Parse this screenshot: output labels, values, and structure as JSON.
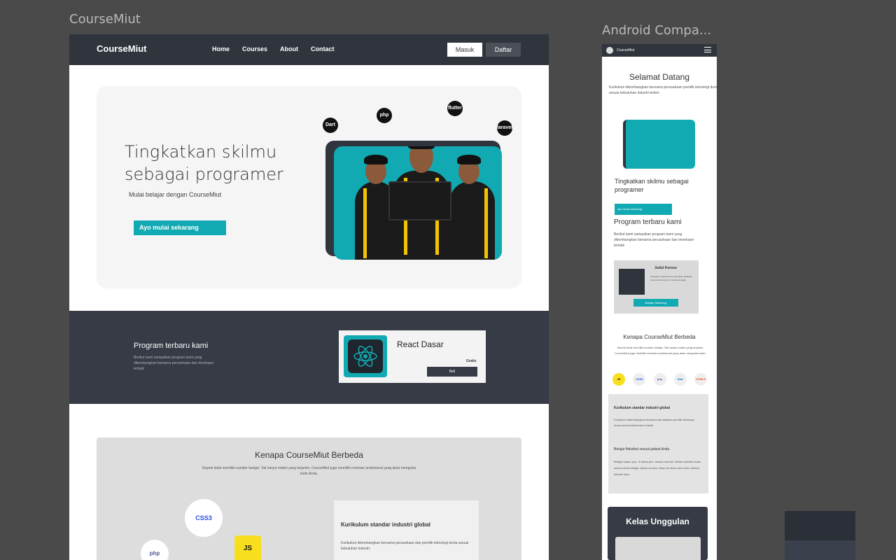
{
  "canvas": {
    "desktop_frame_label": "CourseMiut",
    "mobile_frame_label": "Android Compa..."
  },
  "desktop": {
    "nav": {
      "brand": "CourseMiut",
      "links": [
        "Home",
        "Courses",
        "About",
        "Contact"
      ],
      "login": "Masuk",
      "register": "Daftar"
    },
    "hero": {
      "title": "Tingkatkan skilmu sebagai programer",
      "subtitle": "Mulai belajar dengan CourseMiut",
      "cta": "Ayo mulai sekarang",
      "tech_badges": [
        "Dart",
        "php",
        "flutter",
        "laravel"
      ]
    },
    "program": {
      "title": "Program terbaru kami",
      "description": "Berikut kami sampaikan program kami yang dikembangkan bersama perusahaan dan developer terbaik",
      "card": {
        "title": "React Dasar",
        "price": "Gratis",
        "button": "Beli"
      }
    },
    "why": {
      "title": "Kenapa CourseMiut Berbeda",
      "description": "Seperti tidak memiliki sumber belajar. Tak hanya materi yang terjamin, CourseMiut juga memiliki reviewer profesional yang akan mengulas kode Anda.",
      "card_title": "Kurikulum standar industri global",
      "card_desc": "Kurikulum dikembangkan bersama perusahaan dan pemilik teknologi dunia sesuai kebutuhan industri.",
      "icons": [
        "CSS3",
        "JS",
        "php"
      ]
    }
  },
  "mobile": {
    "brand": "CourseMiut",
    "welcome": "Selamat Datang",
    "welcome_desc": "Kurikulum dikembangkan bersama perusahaan pemilik teknologi dunia sesuai kebutuhan industri terkini.",
    "hero_title": "Tingkatkan skilmu sebagai programer",
    "cta": "Ayo mulai sekarang",
    "program_title": "Program terbaru kami",
    "program_desc": "Berikut kami sampaikan program kami yang dikembangkan bersama perusahaan dan developer terbaik",
    "card": {
      "title": "Judul Kursus",
      "desc": "Deskripsi singkat kursus yang akan dipelajari oleh peserta kursus ini secara lengkap",
      "button": "Belajar Sekarang"
    },
    "why_title": "Kenapa CourseMiut Berbeda",
    "why_desc": "Seperti tidak memiliki sumber belajar. Tak hanya materi yang terjamin, CourseMiut juga memiliki reviewer profesional yang akan mengulas kode.",
    "icons": [
      "JS",
      "CSS3",
      "php",
      "Dart",
      "HTML5"
    ],
    "feature1_title": "Kurikulum standar industri global",
    "feature1_desc": "Kurikulum dikembangkan bersama perusahaan pemilik teknologi dunia sesuai kebutuhan industri.",
    "feature2_title": "Belajar fleksibel sesuai jadwal Anda",
    "feature2_desc": "Belajar kapan pun, di mana pun, secara mandiri. Bebas memilih kelas sesuai minat belajar. Akses seumur hidup ke kelas dan forum diskusi setelah lulus.",
    "kelas_title": "Kelas Unggulan"
  },
  "colors": {
    "nav_dark": "#2f343d",
    "accent_teal": "#12aab2",
    "section_dark": "#363b45"
  }
}
